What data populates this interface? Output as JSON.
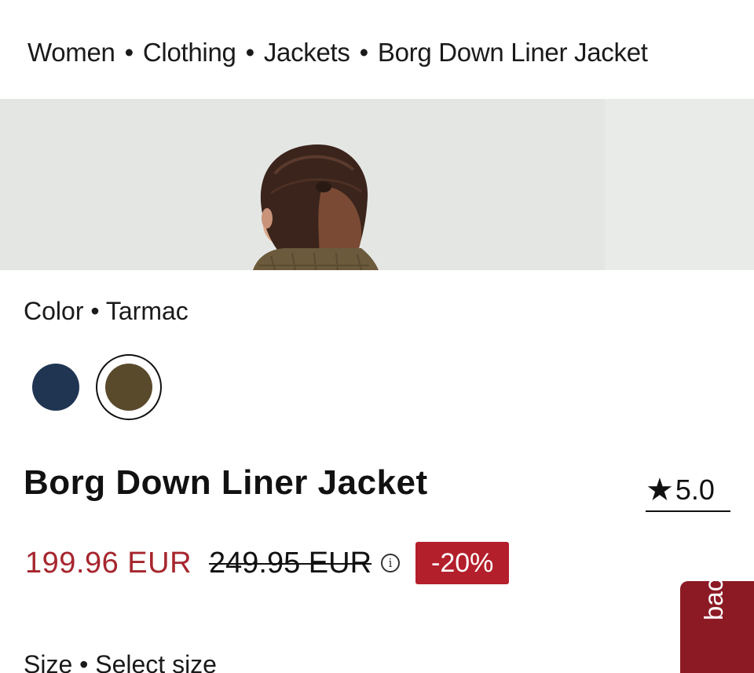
{
  "breadcrumb": {
    "items": [
      "Women",
      "Clothing",
      "Jackets",
      "Borg Down Liner Jacket"
    ],
    "separator": "•"
  },
  "color": {
    "label": "Color",
    "separator": "•",
    "selected": "Tarmac",
    "swatches": [
      {
        "name": "navy",
        "hex": "#1f3552"
      },
      {
        "name": "Tarmac",
        "hex": "#5a4a2c"
      }
    ]
  },
  "product": {
    "title": "Borg Down Liner Jacket",
    "rating": "5.0",
    "rating_icon": "star-icon"
  },
  "price": {
    "sale": "199.96 EUR",
    "original": "249.95 EUR",
    "info_icon": "info-icon",
    "info_glyph": "i",
    "discount": "-20%",
    "sale_color": "#a6262e",
    "badge_color": "#b31f2b"
  },
  "size": {
    "label": "Size",
    "separator": "•",
    "value": "Select size"
  },
  "feedback": {
    "label": "Feedback",
    "visible_text": "back",
    "color": "#8c1a24"
  },
  "hero": {
    "background": "#e4e6e3"
  }
}
